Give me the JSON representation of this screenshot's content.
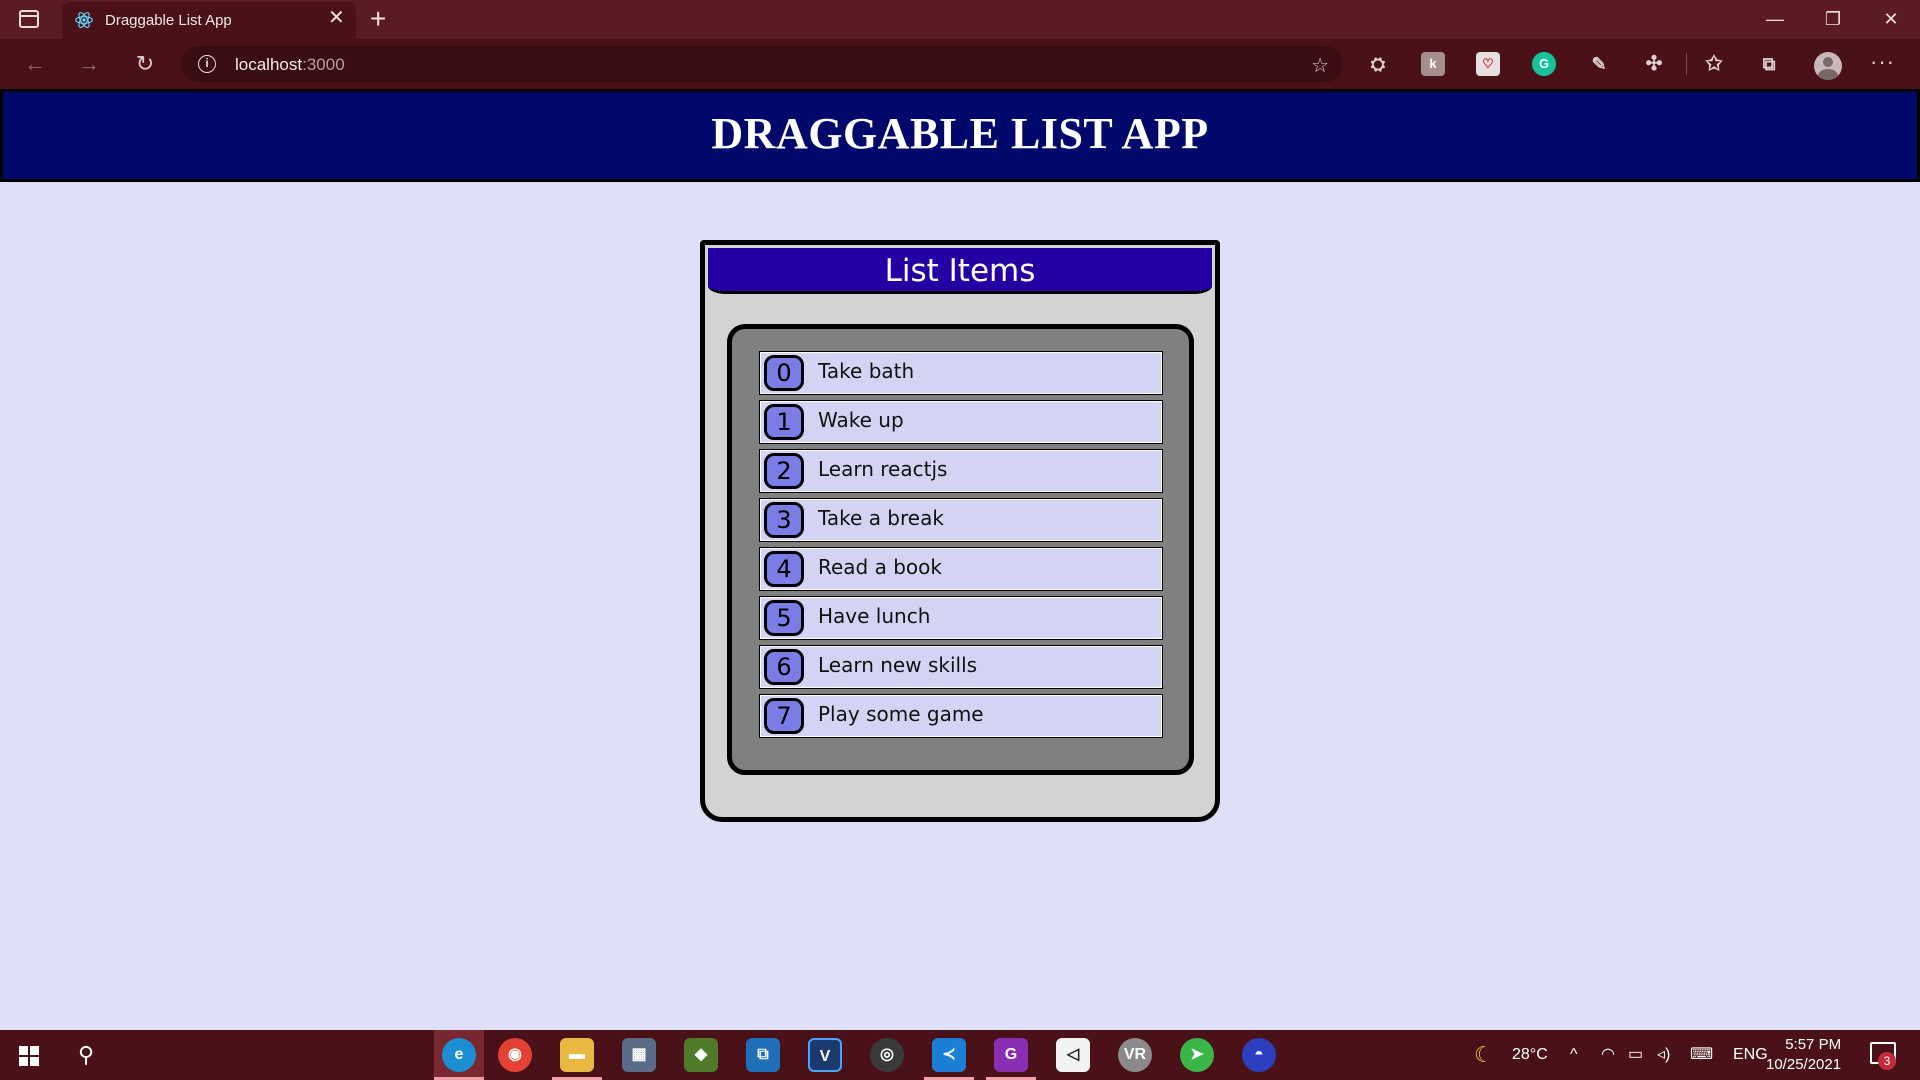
{
  "browser": {
    "tab_title": "Draggable List App",
    "url_host": "localhost",
    "url_port": ":3000",
    "close_glyph": "✕",
    "new_tab_glyph": "+",
    "minimize_glyph": "—",
    "restore_glyph": "❐",
    "close_window_glyph": "✕",
    "back_glyph": "←",
    "forward_glyph": "→",
    "refresh_glyph": "↻",
    "info_glyph": "i",
    "menu_glyph": "···"
  },
  "page": {
    "title": "DRAGGABLE LIST APP"
  },
  "card": {
    "title": "List Items",
    "items": [
      {
        "index": "0",
        "label": "Take bath"
      },
      {
        "index": "1",
        "label": "Wake up"
      },
      {
        "index": "2",
        "label": "Learn reactjs"
      },
      {
        "index": "3",
        "label": "Take a break"
      },
      {
        "index": "4",
        "label": "Read a book"
      },
      {
        "index": "5",
        "label": "Have lunch"
      },
      {
        "index": "6",
        "label": "Learn new skills"
      },
      {
        "index": "7",
        "label": "Play some game"
      }
    ]
  },
  "taskbar": {
    "temperature": "28°C",
    "language": "ENG",
    "time": "5:57 PM",
    "date": "10/25/2021",
    "notification_count": "3"
  },
  "colors": {
    "header_bg": "#00096b",
    "card_header_bg": "#2400a4",
    "index_badge_bg": "#7b7de7",
    "item_bg": "#d3d4f3",
    "page_bg": "#dde0f7"
  }
}
